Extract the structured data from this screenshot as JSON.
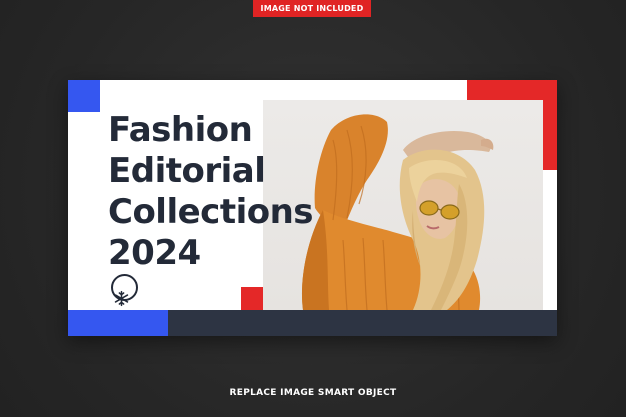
{
  "top_badge": {
    "label": "IMAGE NOT INCLUDED"
  },
  "banner": {
    "title_lines": [
      "Fashion",
      "Editorial",
      "Collections",
      "2024"
    ],
    "icon": "snowflake-icon",
    "photo": "woman-in-orange-sweater-and-sunglasses"
  },
  "bottom_caption": {
    "label": "REPLACE  IMAGE SMART OBJECT"
  },
  "colors": {
    "background": "#2b2b2b",
    "accent_red": "#e42828",
    "accent_blue": "#3557f0",
    "navy": "#2d3443",
    "title_text": "#232a38"
  }
}
